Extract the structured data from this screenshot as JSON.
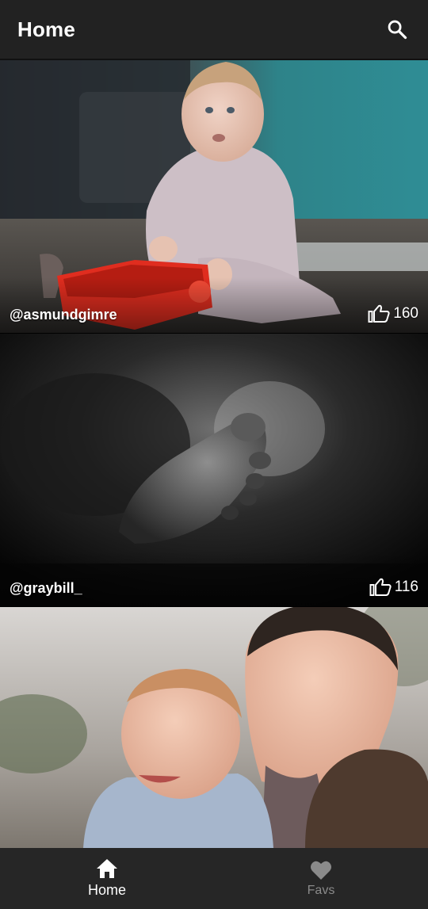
{
  "app_bar": {
    "title": "Home",
    "search_icon": "search-icon"
  },
  "feed": {
    "items": [
      {
        "author": "@asmundgimre",
        "likes": "160",
        "like_icon": "thumbs-up-icon"
      },
      {
        "author": "@graybill_",
        "likes": "116",
        "like_icon": "thumbs-up-icon"
      },
      {
        "author": "",
        "likes": "",
        "like_icon": "thumbs-up-icon"
      }
    ]
  },
  "bottom_nav": {
    "items": [
      {
        "label": "Home",
        "icon": "home-icon",
        "active": true
      },
      {
        "label": "Favs",
        "icon": "heart-icon",
        "active": false
      }
    ]
  },
  "colors": {
    "app_bar_bg": "#222222",
    "bottom_nav_bg": "#262626",
    "active": "#ffffff",
    "inactive": "#8a8a8a"
  }
}
